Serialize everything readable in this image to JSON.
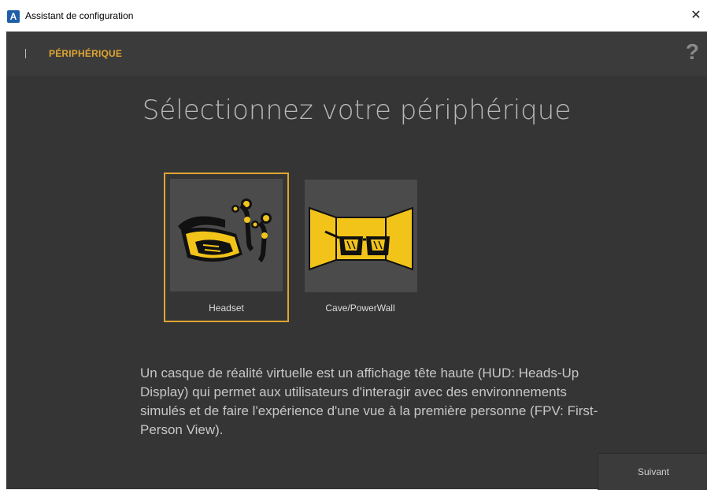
{
  "window": {
    "title": "Assistant de configuration",
    "app_icon_letter": "A",
    "close_glyph": "✕"
  },
  "topbar": {
    "step": "PÉRIPHÉRIQUE",
    "help_glyph": "?"
  },
  "heading": "Sélectionnez votre périphérique",
  "devices": [
    {
      "label": "Headset",
      "selected": true,
      "icon": "vr-headset-icon"
    },
    {
      "label": "Cave/PowerWall",
      "selected": false,
      "icon": "cave-powerwall-icon"
    }
  ],
  "description": "Un casque de réalité virtuelle est un affichage tête haute (HUD: Heads-Up Display) qui permet aux utilisateurs d'interagir avec des environnements simulés et de faire l'expérience d'une vue à la première personne (FPV: First-Person View).",
  "footer": {
    "next_label": "Suivant"
  },
  "colors": {
    "accent": "#e0a531",
    "icon_yellow": "#f2c41a",
    "background": "#353535",
    "tile_bg": "#4b4b4b"
  }
}
